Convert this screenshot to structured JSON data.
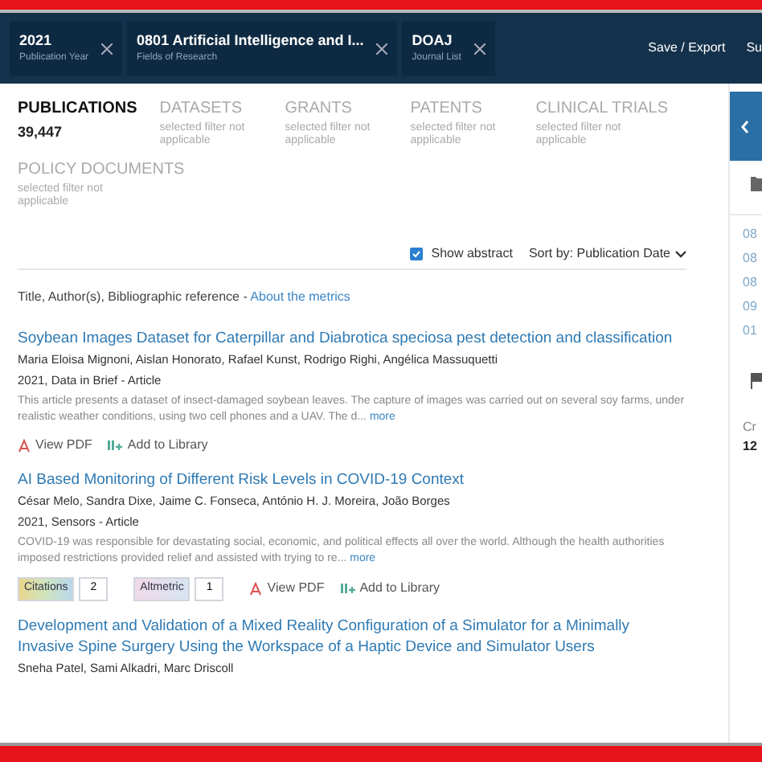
{
  "filters": [
    {
      "value": "2021",
      "label": "Publication Year"
    },
    {
      "value": "0801 Artificial Intelligence and I...",
      "label": "Fields of Research"
    },
    {
      "value": "DOAJ",
      "label": "Journal List"
    }
  ],
  "header_actions": [
    "Save / Export",
    "Su"
  ],
  "tabs": [
    {
      "label": "PUBLICATIONS",
      "count": "39,447",
      "selected": true
    },
    {
      "label": "DATASETS",
      "note": "selected filter not applicable",
      "selected": false
    },
    {
      "label": "GRANTS",
      "note": "selected filter not applicable",
      "selected": false
    },
    {
      "label": "PATENTS",
      "note": "selected filter not applicable",
      "selected": false
    },
    {
      "label": "CLINICAL TRIALS",
      "note": "selected filter not applicable",
      "selected": false
    },
    {
      "label": "POLICY DOCUMENTS",
      "note": "selected filter not applicable",
      "selected": false
    }
  ],
  "show_abstract": {
    "label": "Show abstract",
    "checked": true
  },
  "sort": {
    "label": "Sort by: Publication Date"
  },
  "caption": {
    "text": "Title, Author(s), Bibliographic reference - ",
    "link": "About the metrics"
  },
  "articles": [
    {
      "title": "Soybean Images Dataset for Caterpillar and Diabrotica speciosa pest detection and classification",
      "authors": "Maria Eloisa Mignoni, Aislan Honorato, Rafael Kunst, Rodrigo Righi, Angélica Massuquetti",
      "meta": "2021, Data in Brief - Article",
      "abstract": "This article presents a dataset of insect-damaged soybean leaves. The capture of images was carried out on several soy farms, under realistic weather conditions, using two cell phones and a UAV. The d...",
      "more": "more",
      "actions": [
        "View PDF",
        "Add to Library"
      ]
    },
    {
      "title": "AI Based Monitoring of Different Risk Levels in COVID-19 Context",
      "authors": "César Melo, Sandra Dixe, Jaime C. Fonseca, António H. J. Moreira, João Borges",
      "meta": "2021, Sensors - Article",
      "abstract": "COVID-19 was responsible for devastating social, economic, and political effects all over the world. Although the health authorities imposed restrictions provided relief and assisted with trying to re...",
      "more": "more",
      "badges": [
        {
          "kind": "citations",
          "label": "Citations",
          "count": "2"
        },
        {
          "kind": "altmetric",
          "label": "Altmetric",
          "count": "1"
        }
      ],
      "actions": [
        "View PDF",
        "Add to Library"
      ]
    },
    {
      "title": "Development and Validation of a Mixed Reality Configuration of a Simulator for a Minimally Invasive Spine Surgery Using the Workspace of a Haptic Device and Simulator Users",
      "authors": "Sneha Patel, Sami Alkadri, Marc Driscoll"
    }
  ],
  "side_panel": {
    "codes": [
      "08",
      "08",
      "08",
      "09",
      "01"
    ],
    "stat_label": "Cr",
    "stat_value": "12"
  }
}
